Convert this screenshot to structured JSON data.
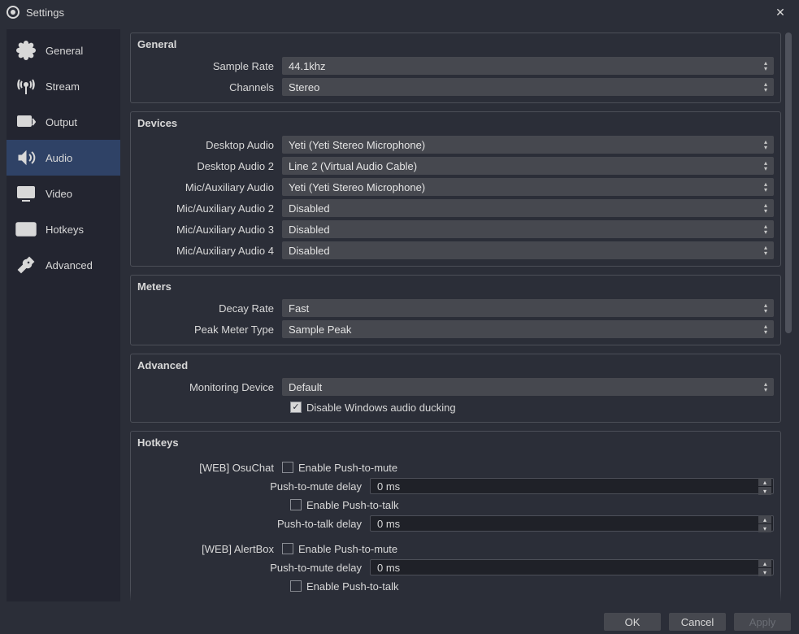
{
  "window": {
    "title": "Settings"
  },
  "sidebar": {
    "items": [
      {
        "label": "General"
      },
      {
        "label": "Stream"
      },
      {
        "label": "Output"
      },
      {
        "label": "Audio"
      },
      {
        "label": "Video"
      },
      {
        "label": "Hotkeys"
      },
      {
        "label": "Advanced"
      }
    ]
  },
  "sections": {
    "general": {
      "title": "General",
      "sample_rate_label": "Sample Rate",
      "sample_rate_value": "44.1khz",
      "channels_label": "Channels",
      "channels_value": "Stereo"
    },
    "devices": {
      "title": "Devices",
      "rows": [
        {
          "label": "Desktop Audio",
          "value": "Yeti (Yeti Stereo Microphone)"
        },
        {
          "label": "Desktop Audio 2",
          "value": "Line 2 (Virtual Audio Cable)"
        },
        {
          "label": "Mic/Auxiliary Audio",
          "value": "Yeti (Yeti Stereo Microphone)"
        },
        {
          "label": "Mic/Auxiliary Audio 2",
          "value": "Disabled"
        },
        {
          "label": "Mic/Auxiliary Audio 3",
          "value": "Disabled"
        },
        {
          "label": "Mic/Auxiliary Audio 4",
          "value": "Disabled"
        }
      ]
    },
    "meters": {
      "title": "Meters",
      "decay_label": "Decay Rate",
      "decay_value": "Fast",
      "peak_label": "Peak Meter Type",
      "peak_value": "Sample Peak"
    },
    "advanced": {
      "title": "Advanced",
      "monitor_label": "Monitoring Device",
      "monitor_value": "Default",
      "ducking_label": "Disable Windows audio ducking"
    },
    "hotkeys": {
      "title": "Hotkeys",
      "blocks": [
        {
          "name": "[WEB] OsuChat",
          "ptm_enable": "Enable Push-to-mute",
          "ptm_delay_label": "Push-to-mute delay",
          "ptm_delay_value": "0 ms",
          "ptt_enable": "Enable Push-to-talk",
          "ptt_delay_label": "Push-to-talk delay",
          "ptt_delay_value": "0 ms"
        },
        {
          "name": "[WEB] AlertBox",
          "ptm_enable": "Enable Push-to-mute",
          "ptm_delay_label": "Push-to-mute delay",
          "ptm_delay_value": "0 ms",
          "ptt_enable": "Enable Push-to-talk"
        }
      ]
    }
  },
  "footer": {
    "ok": "OK",
    "cancel": "Cancel",
    "apply": "Apply"
  }
}
